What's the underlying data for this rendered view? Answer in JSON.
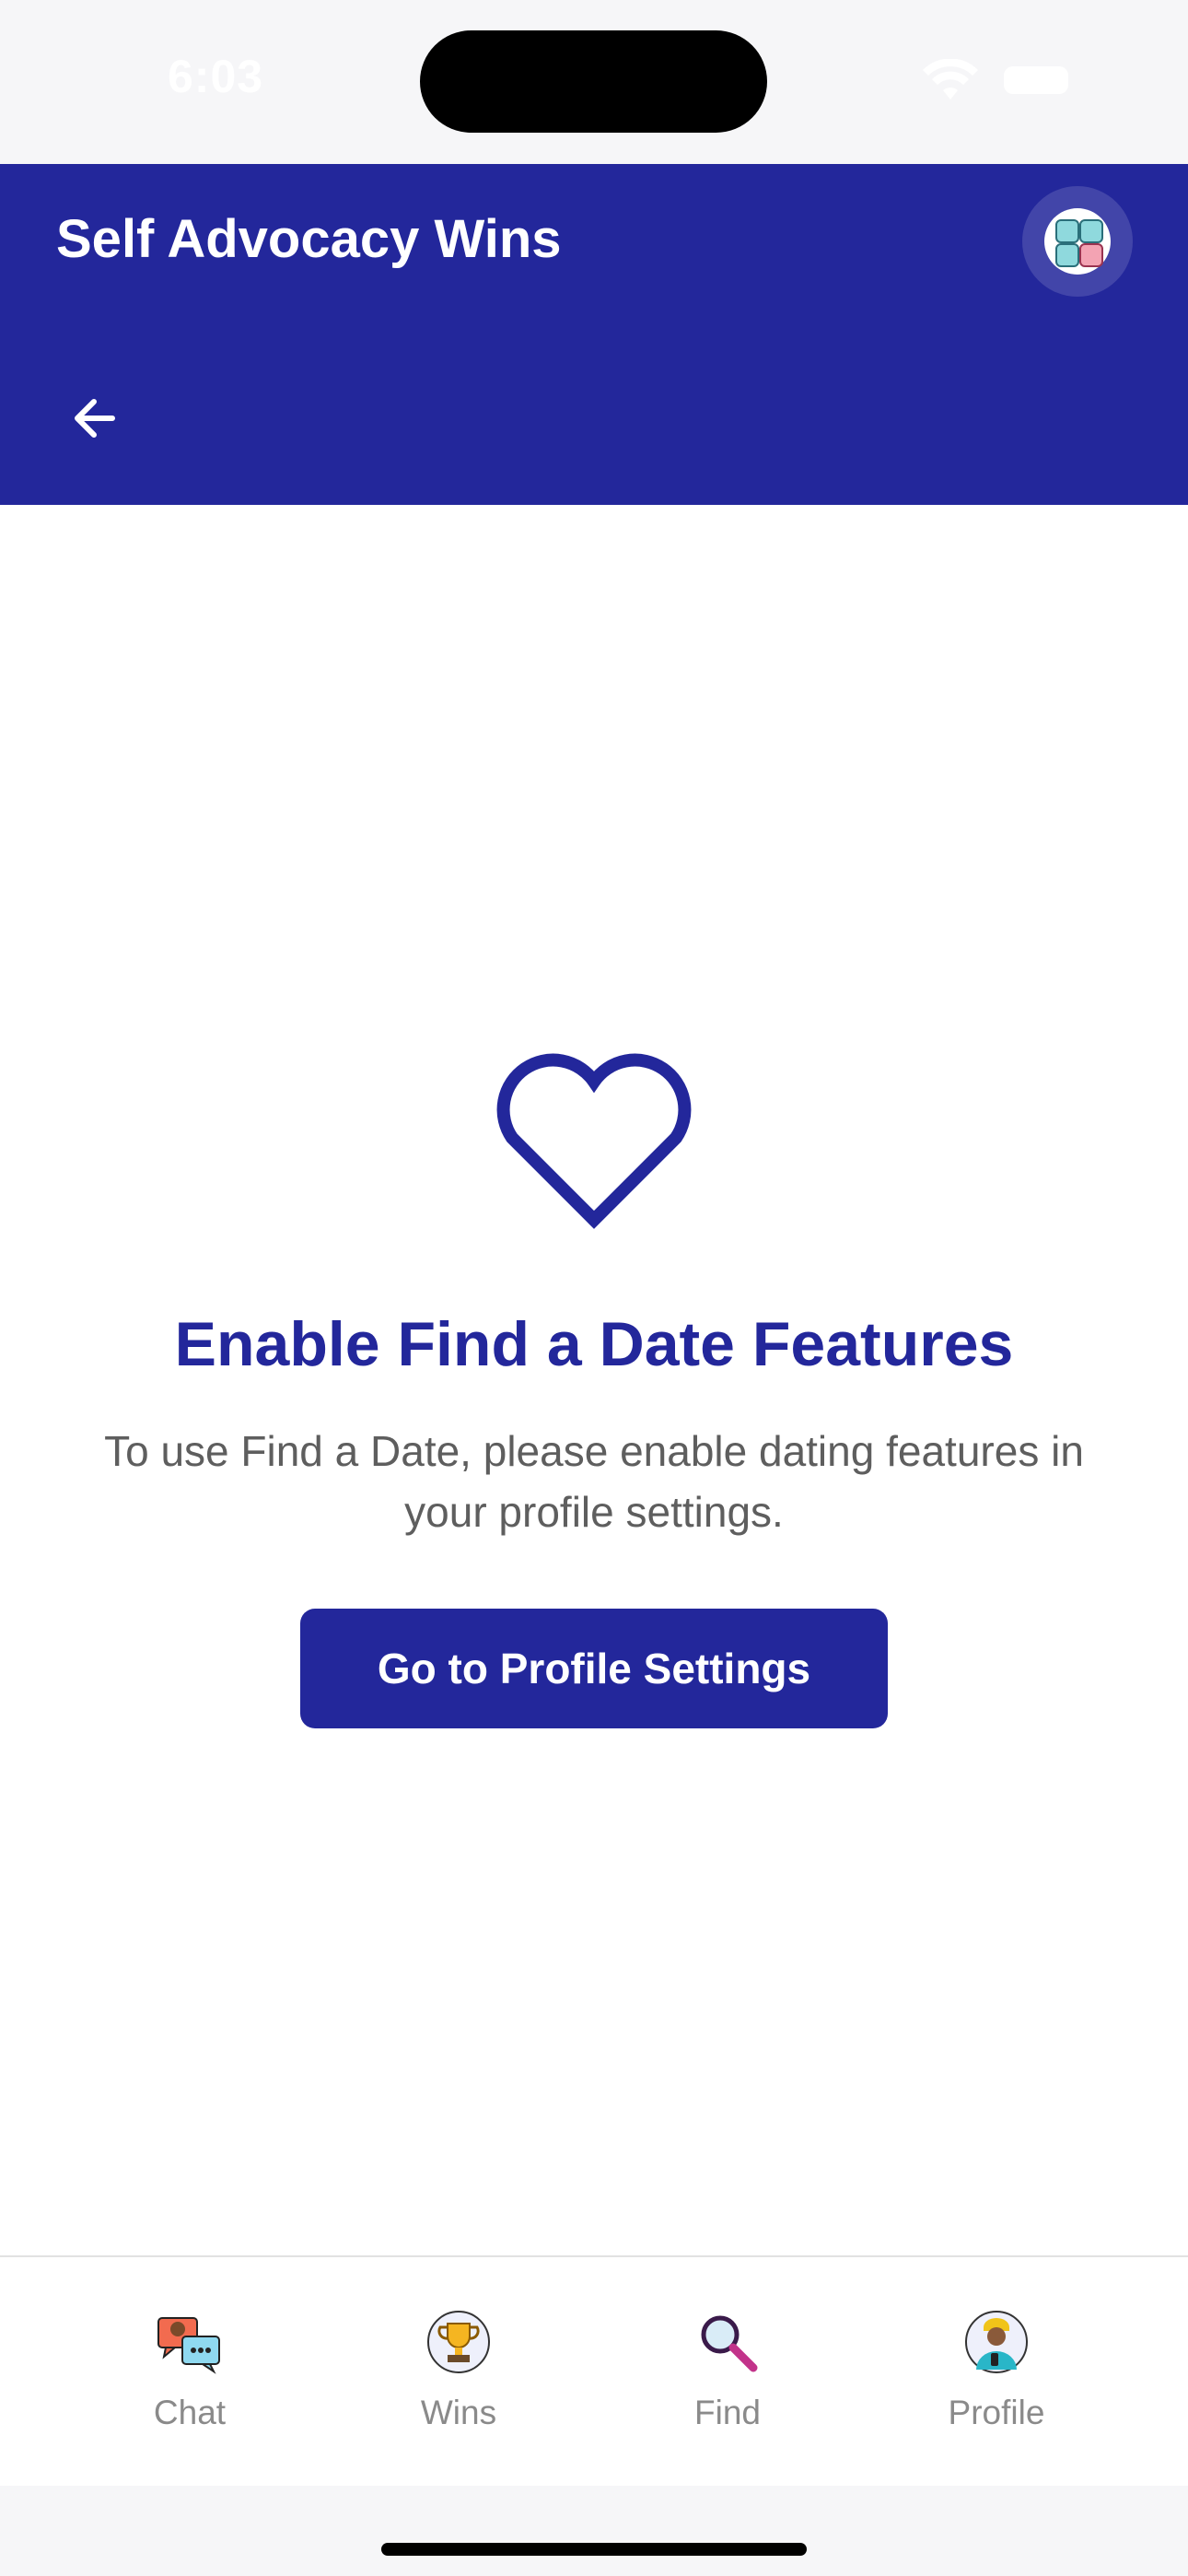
{
  "status_bar": {
    "time": "6:03"
  },
  "header": {
    "title": "Self Advocacy Wins"
  },
  "main": {
    "headline": "Enable Find a Date Features",
    "description": "To use Find a Date, please enable dating features in your profile settings.",
    "cta_label": "Go to Profile Settings"
  },
  "tabs": [
    {
      "label": "Chat",
      "icon": "chat-icon"
    },
    {
      "label": "Wins",
      "icon": "trophy-icon"
    },
    {
      "label": "Find",
      "icon": "magnifier-icon"
    },
    {
      "label": "Profile",
      "icon": "avatar-icon"
    }
  ],
  "colors": {
    "brand": "#23279b",
    "text_muted": "#5e5e5e",
    "tab_label": "#8a8a8a"
  }
}
